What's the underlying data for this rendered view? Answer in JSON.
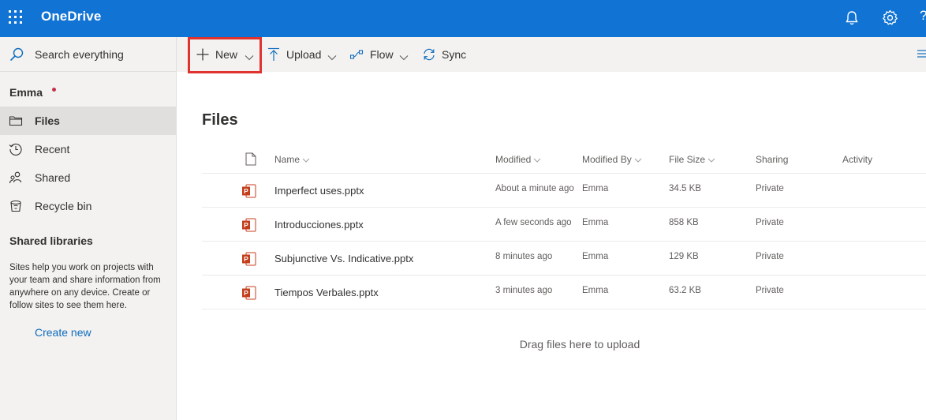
{
  "app": {
    "title": "OneDrive"
  },
  "colors": {
    "header": "#1174d4",
    "accent": "#0f6cbd",
    "highlight": "#e0332f",
    "unread_dot": "#c4314b",
    "powerpoint": "#c43e1c"
  },
  "header": {
    "icons": [
      "app-launcher-icon",
      "bell-icon",
      "gear-icon",
      "help-icon"
    ],
    "help_glyph": "?"
  },
  "sidebar": {
    "search_placeholder": "Search everything",
    "user": "Emma",
    "items": [
      {
        "label": "Files",
        "icon": "folder-icon",
        "selected": true
      },
      {
        "label": "Recent",
        "icon": "clock-icon",
        "selected": false
      },
      {
        "label": "Shared",
        "icon": "people-icon",
        "selected": false
      },
      {
        "label": "Recycle bin",
        "icon": "trash-icon",
        "selected": false
      }
    ],
    "shared_libraries": {
      "title": "Shared libraries",
      "description": "Sites help you work on projects with your team and share information from anywhere on any device. Create or follow sites to see them here.",
      "create_link": "Create new"
    }
  },
  "commandbar": {
    "new_label": "New",
    "upload_label": "Upload",
    "flow_label": "Flow",
    "sync_label": "Sync"
  },
  "main": {
    "title": "Files",
    "columns": {
      "name": "Name",
      "modified": "Modified",
      "modified_by": "Modified By",
      "file_size": "File Size",
      "sharing": "Sharing",
      "activity": "Activity"
    },
    "files": [
      {
        "name": "Imperfect uses.pptx",
        "modified": "About a minute ago",
        "modified_by": "Emma",
        "size": "34.5 KB",
        "sharing": "Private"
      },
      {
        "name": "Introducciones.pptx",
        "modified": "A few seconds ago",
        "modified_by": "Emma",
        "size": "858 KB",
        "sharing": "Private"
      },
      {
        "name": "Subjunctive Vs. Indicative.pptx",
        "modified": "8 minutes ago",
        "modified_by": "Emma",
        "size": "129 KB",
        "sharing": "Private"
      },
      {
        "name": "Tiempos Verbales.pptx",
        "modified": "3 minutes ago",
        "modified_by": "Emma",
        "size": "63.2 KB",
        "sharing": "Private"
      }
    ],
    "drop_hint": "Drag files here to upload"
  }
}
